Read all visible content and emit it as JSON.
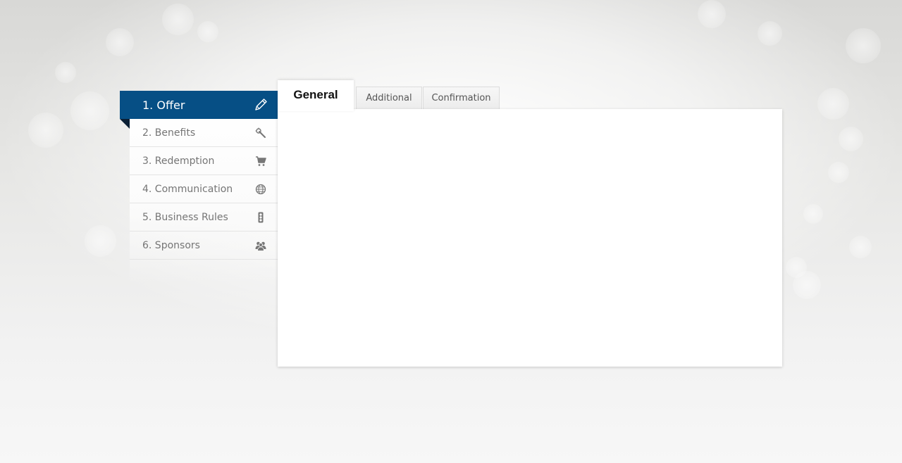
{
  "sidebar": {
    "active": {
      "label": "1. Offer",
      "icon": "pencil-icon"
    },
    "items": [
      {
        "label": "2. Benefits",
        "icon": "magic-wand-icon"
      },
      {
        "label": "3. Redemption",
        "icon": "cart-icon"
      },
      {
        "label": "4. Communication",
        "icon": "globe-icon"
      },
      {
        "label": "5. Business Rules",
        "icon": "traffic-light-icon"
      },
      {
        "label": "6. Sponsors",
        "icon": "users-icon"
      }
    ]
  },
  "tabs": [
    {
      "label": "General",
      "active": true
    },
    {
      "label": "Additional",
      "active": false
    },
    {
      "label": "Confirmation",
      "active": false
    }
  ],
  "colors": {
    "accent": "#064f85",
    "fold": "#0a1f35",
    "nav_text": "#757575"
  }
}
